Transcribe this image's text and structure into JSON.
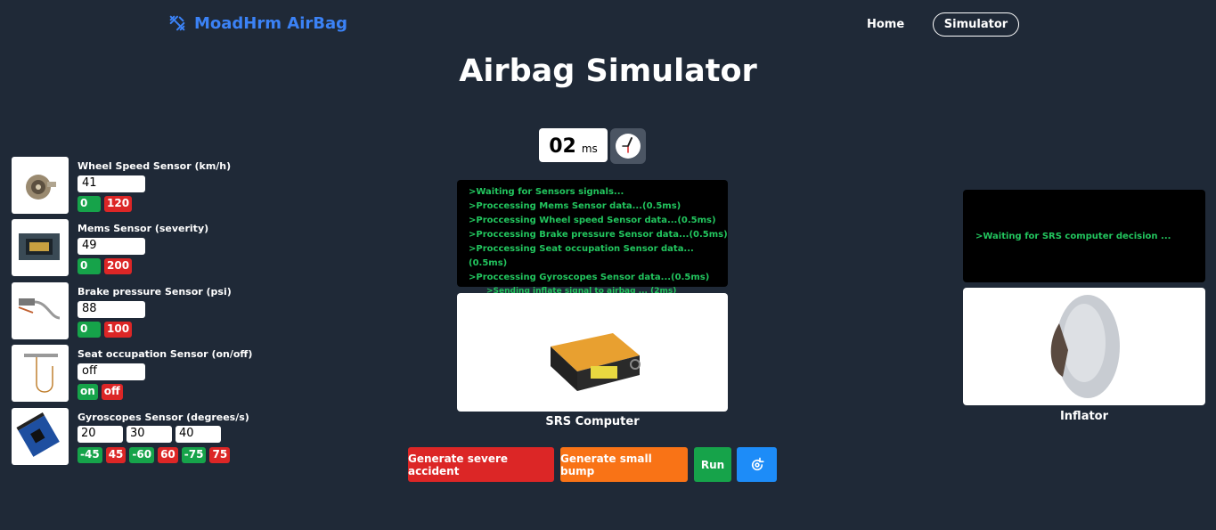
{
  "nav": {
    "brand": "MoadHrm AirBag",
    "home": "Home",
    "simulator": "Simulator"
  },
  "page_title": "Airbag Simulator",
  "timer": {
    "value": "02",
    "unit": "ms"
  },
  "sensors": [
    {
      "label": "Wheel Speed Sensor (km/h)",
      "value": "41",
      "min": "0",
      "max": "120"
    },
    {
      "label": "Mems Sensor (severity)",
      "value": "49",
      "min": "0",
      "max": "200"
    },
    {
      "label": "Brake pressure Sensor (psi)",
      "value": "88",
      "min": "0",
      "max": "100"
    },
    {
      "label": "Seat occupation Sensor (on/off)",
      "value": "off",
      "min": "on",
      "max": "off"
    }
  ],
  "gyro": {
    "label": "Gyroscopes Sensor (degrees/s)",
    "values": [
      "20",
      "30",
      "40"
    ],
    "ranges": [
      [
        "-45",
        "45"
      ],
      [
        "-60",
        "60"
      ],
      [
        "-75",
        "75"
      ]
    ]
  },
  "srs_log": [
    ">Waiting for Sensors signals...",
    ">Proccessing Mems Sensor data...(0.5ms)",
    ">Proccessing Wheel speed Sensor data...(0.5ms)",
    ">Proccessing Brake pressure Sensor data...(0.5ms)",
    ">Proccessing Seat occupation Sensor data...(0.5ms)",
    ">Proccessing Gyroscopes Sensor data...(0.5ms)"
  ],
  "srs_log_sub": ">Sending inflate signal to airbag ... (2ms)",
  "inflator_log": ">Waiting for SRS computer decision ...",
  "srs_caption": "SRS Computer",
  "inflator_caption": "Inflator",
  "buttons": {
    "severe": "Generate severe accident",
    "bump": "Generate small bump",
    "run": "Run"
  },
  "colors": {
    "background": "#1f2937",
    "accent": "#3b82f6",
    "green": "#16a34a",
    "red": "#dc2626",
    "orange": "#f97316",
    "blue": "#1d8cf8",
    "terminal_text": "#22c55e"
  }
}
